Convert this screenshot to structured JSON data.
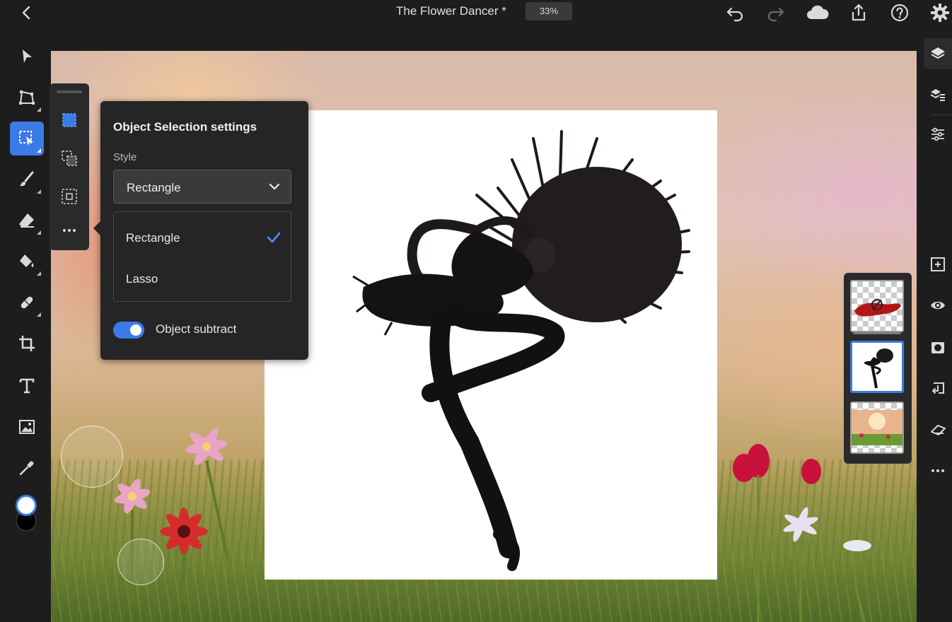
{
  "header": {
    "document_title": "The Flower Dancer *",
    "zoom_level": "33%"
  },
  "selection_settings": {
    "title": "Object Selection settings",
    "style_label": "Style",
    "style_selected": "Rectangle",
    "style_options": [
      {
        "label": "Rectangle",
        "selected": true
      },
      {
        "label": "Lasso",
        "selected": false
      }
    ],
    "object_subtract_label": "Object subtract",
    "object_subtract_on": true
  },
  "icons": {
    "left_tools": [
      "move-icon",
      "transform-icon",
      "object-selection-icon",
      "brush-icon",
      "eraser-icon",
      "fill-icon",
      "healing-icon",
      "crop-icon",
      "type-icon",
      "place-image-icon",
      "eyedropper-icon"
    ],
    "right_tools": [
      "layers-icon",
      "layer-properties-icon",
      "adjustments-icon",
      "add-layer-icon",
      "visibility-icon",
      "mask-icon",
      "merge-down-icon",
      "clear-layer-icon",
      "more-icon"
    ]
  },
  "colors": {
    "accent": "#3b7be8",
    "foreground_color": "#ffffff",
    "background_color": "#000000"
  },
  "layers": [
    "adjustment-layer-thumbnail",
    "dancer-layer-thumbnail",
    "background-layer-thumbnail"
  ],
  "active_layer_index": 1
}
